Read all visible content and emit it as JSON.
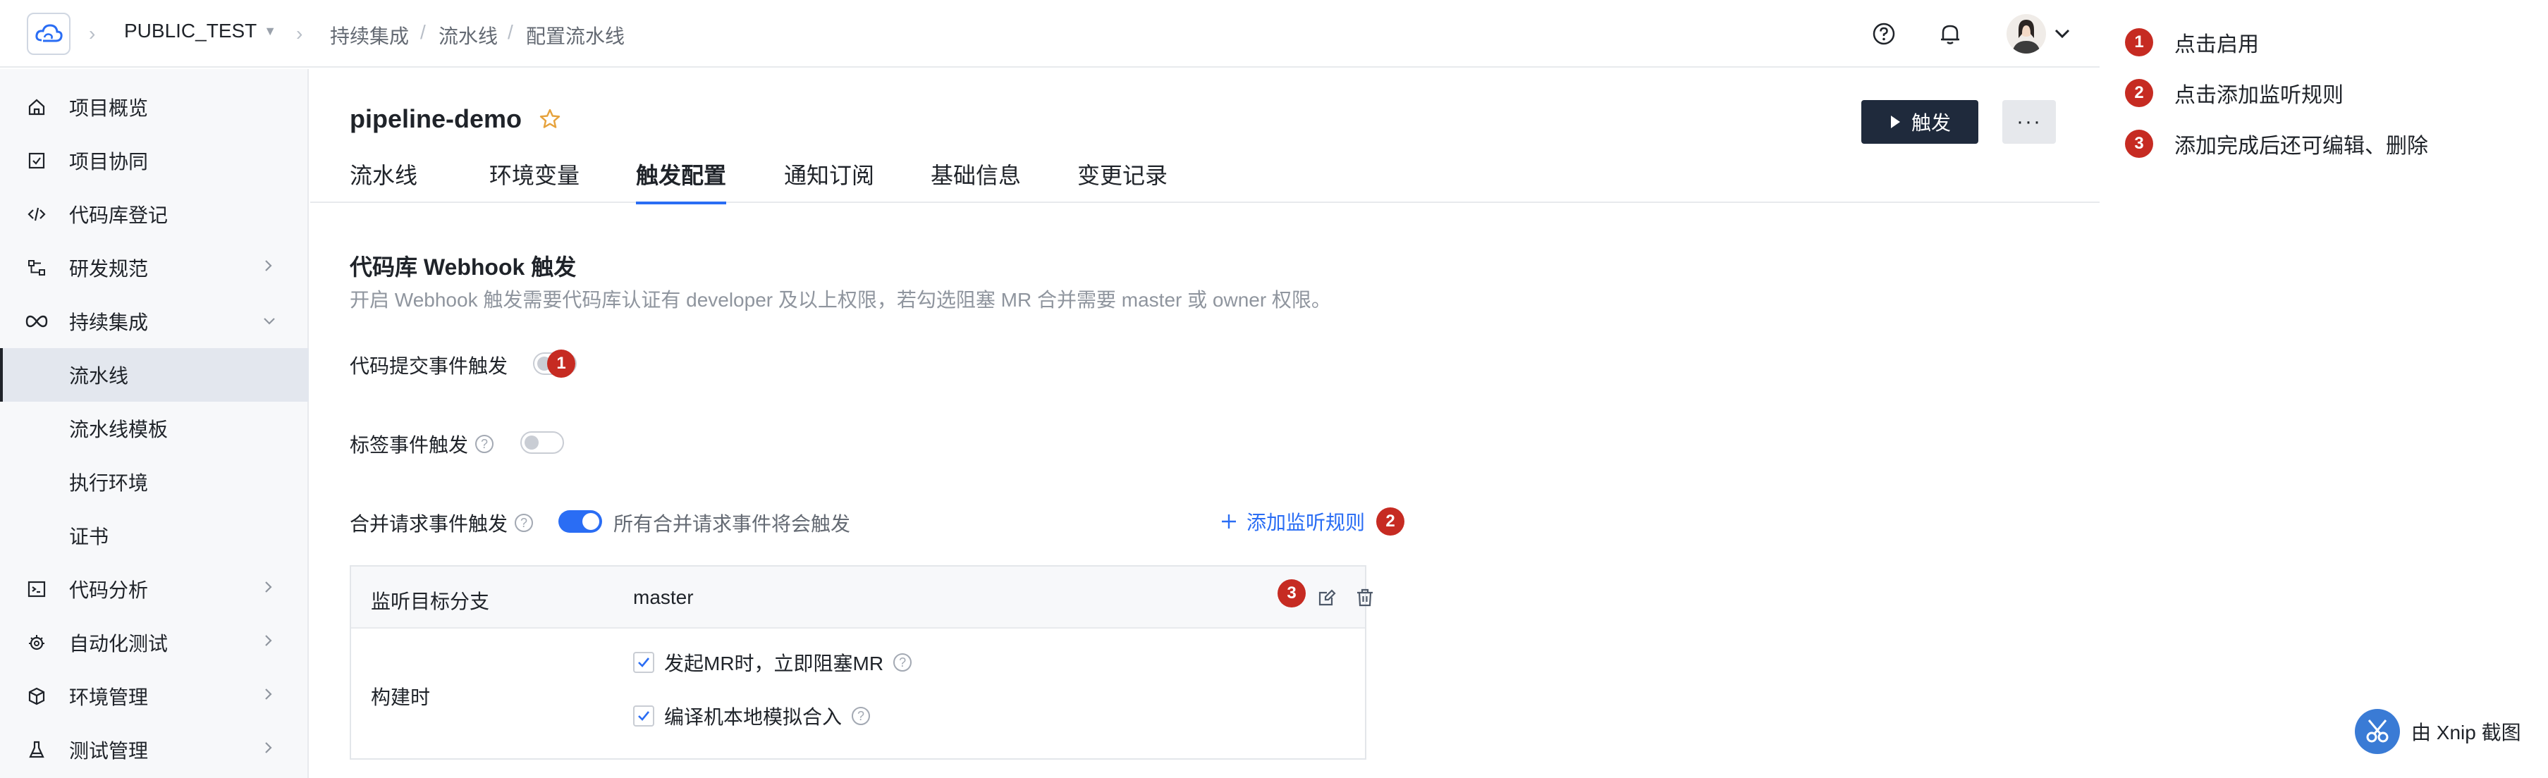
{
  "header": {
    "project_name": "PUBLIC_TEST",
    "breadcrumb": [
      "持续集成",
      "流水线",
      "配置流水线"
    ]
  },
  "sidebar": {
    "items": [
      {
        "label": "项目概览",
        "icon": "home-icon",
        "has_chevron": false,
        "active": false
      },
      {
        "label": "项目协同",
        "icon": "checkbox-icon",
        "has_chevron": false,
        "active": false
      },
      {
        "label": "代码库登记",
        "icon": "code-icon",
        "has_chevron": false,
        "active": false
      },
      {
        "label": "研发规范",
        "icon": "flow-icon",
        "has_chevron": true,
        "active": false
      },
      {
        "label": "持续集成",
        "icon": "infinity-icon",
        "has_chevron": true,
        "expanded": true,
        "active": false
      },
      {
        "label": "流水线",
        "icon": "",
        "has_chevron": false,
        "active": true
      },
      {
        "label": "流水线模板",
        "icon": "",
        "has_chevron": false,
        "active": false
      },
      {
        "label": "执行环境",
        "icon": "",
        "has_chevron": false,
        "active": false
      },
      {
        "label": "证书",
        "icon": "",
        "has_chevron": false,
        "active": false
      },
      {
        "label": "代码分析",
        "icon": "terminal-icon",
        "has_chevron": true,
        "active": false
      },
      {
        "label": "自动化测试",
        "icon": "bug-icon",
        "has_chevron": true,
        "active": false
      },
      {
        "label": "环境管理",
        "icon": "cube-icon",
        "has_chevron": true,
        "active": false
      },
      {
        "label": "测试管理",
        "icon": "flask-icon",
        "has_chevron": true,
        "active": false
      }
    ]
  },
  "page": {
    "title": "pipeline-demo",
    "trigger_label": "触发",
    "more_label": "···",
    "tabs": [
      "流水线",
      "环境变量",
      "触发配置",
      "通知订阅",
      "基础信息",
      "变更记录"
    ],
    "active_tab": "触发配置"
  },
  "webhook": {
    "title": "代码库 Webhook 触发",
    "desc": "开启 Webhook 触发需要代码库认证有 developer 及以上权限，若勾选阻塞 MR 合并需要 master 或 owner 权限。",
    "push_label": "代码提交事件触发",
    "tag_label": "标签事件触发",
    "mr_label": "合并请求事件触发",
    "mr_hint": "所有合并请求事件将会触发",
    "add_rule": "添加监听规则",
    "push_enabled": false,
    "tag_enabled": false,
    "mr_enabled": true
  },
  "rule": {
    "branch_key": "监听目标分支",
    "branch_value": "master",
    "build_key": "构建时",
    "options": [
      "发起MR时，立即阻塞MR",
      "编译机本地模拟合入"
    ]
  },
  "annotations": {
    "badges": [
      "1",
      "2",
      "3"
    ],
    "notes": [
      "点击启用",
      "点击添加监听规则",
      "添加完成后还可编辑、删除"
    ]
  },
  "watermark": "由 Xnip 截图",
  "colors": {
    "accent": "#2a6df4",
    "badge": "#c62b22",
    "primary_button": "#1f2a3c"
  }
}
